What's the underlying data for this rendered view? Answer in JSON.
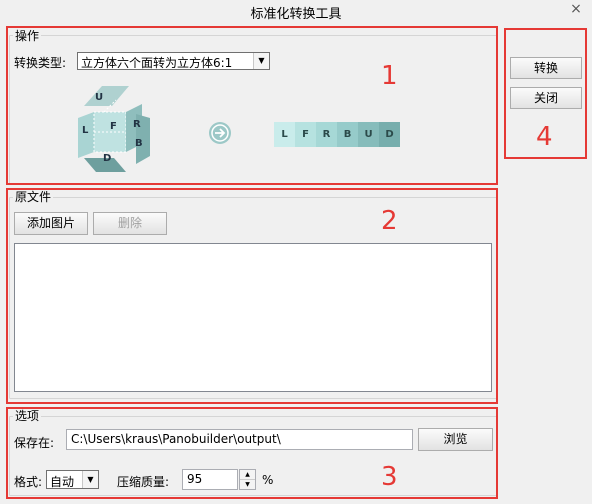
{
  "window": {
    "title": "标准化转换工具",
    "close_glyph": "×"
  },
  "operation": {
    "group_label": "操作",
    "conv_type_label": "转换类型:",
    "conv_type_value": "立方体六个面转为立方体6:1",
    "cube_faces": [
      "U",
      "L",
      "F",
      "R",
      "B",
      "D"
    ],
    "strip_faces": [
      "L",
      "F",
      "R",
      "B",
      "U",
      "D"
    ],
    "strip_colors": [
      "#c9eceb",
      "#b6e2e0",
      "#a6d8d6",
      "#96cbca",
      "#86bcbb",
      "#77aead"
    ]
  },
  "actions": {
    "convert": "转换",
    "close": "关闭"
  },
  "source": {
    "group_label": "原文件",
    "add_image": "添加图片",
    "delete": "删除"
  },
  "options": {
    "group_label": "选项",
    "save_to_label": "保存在:",
    "save_path": "C:\\Users\\kraus\\Panobuilder\\output\\",
    "browse": "浏览",
    "format_label": "格式:",
    "format_value": "自动",
    "quality_label": "压缩质量:",
    "quality_value": "95",
    "quality_unit": "%"
  },
  "annotations": {
    "n1": "1",
    "n2": "2",
    "n3": "3",
    "n4": "4"
  }
}
